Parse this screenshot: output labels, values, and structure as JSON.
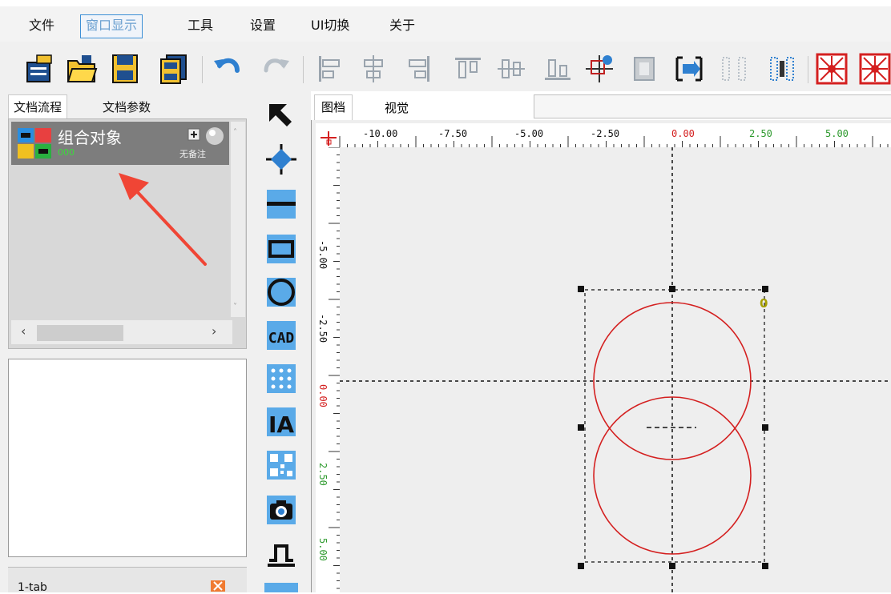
{
  "menu": {
    "items": [
      "文件",
      "窗口显示",
      "工具",
      "设置",
      "UI切换",
      "关于"
    ],
    "active_index": 1
  },
  "left_panel": {
    "tabs": [
      "文档流程",
      "文档参数"
    ],
    "flow_items": [
      {
        "name": "组合对象",
        "sub": "000",
        "note": "无备注"
      }
    ],
    "bottom_tab_label": "1-tab"
  },
  "canvas": {
    "tabs": [
      "图档",
      "视觉"
    ],
    "top_ruler_labels": [
      "-10.00",
      "-7.50",
      "-5.00",
      "-2.50",
      "0.00",
      "2.50",
      "5.00"
    ],
    "left_ruler_labels": [
      "-5.00",
      "-2.50",
      "0.00",
      "2.50",
      "5.00"
    ],
    "object_label": "0"
  },
  "colors": {
    "accent": "#3c8fd6",
    "shape_stroke": "#d42020",
    "arrow": "#f04535"
  }
}
